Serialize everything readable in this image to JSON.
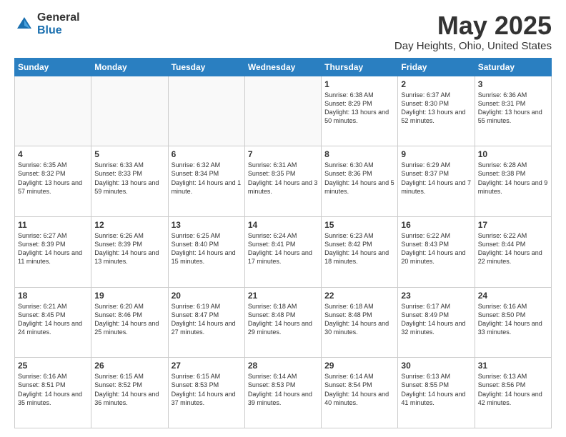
{
  "logo": {
    "general": "General",
    "blue": "Blue"
  },
  "title": "May 2025",
  "subtitle": "Day Heights, Ohio, United States",
  "headers": [
    "Sunday",
    "Monday",
    "Tuesday",
    "Wednesday",
    "Thursday",
    "Friday",
    "Saturday"
  ],
  "weeks": [
    [
      {
        "day": "",
        "text": ""
      },
      {
        "day": "",
        "text": ""
      },
      {
        "day": "",
        "text": ""
      },
      {
        "day": "",
        "text": ""
      },
      {
        "day": "1",
        "text": "Sunrise: 6:38 AM\nSunset: 8:29 PM\nDaylight: 13 hours and 50 minutes."
      },
      {
        "day": "2",
        "text": "Sunrise: 6:37 AM\nSunset: 8:30 PM\nDaylight: 13 hours and 52 minutes."
      },
      {
        "day": "3",
        "text": "Sunrise: 6:36 AM\nSunset: 8:31 PM\nDaylight: 13 hours and 55 minutes."
      }
    ],
    [
      {
        "day": "4",
        "text": "Sunrise: 6:35 AM\nSunset: 8:32 PM\nDaylight: 13 hours and 57 minutes."
      },
      {
        "day": "5",
        "text": "Sunrise: 6:33 AM\nSunset: 8:33 PM\nDaylight: 13 hours and 59 minutes."
      },
      {
        "day": "6",
        "text": "Sunrise: 6:32 AM\nSunset: 8:34 PM\nDaylight: 14 hours and 1 minute."
      },
      {
        "day": "7",
        "text": "Sunrise: 6:31 AM\nSunset: 8:35 PM\nDaylight: 14 hours and 3 minutes."
      },
      {
        "day": "8",
        "text": "Sunrise: 6:30 AM\nSunset: 8:36 PM\nDaylight: 14 hours and 5 minutes."
      },
      {
        "day": "9",
        "text": "Sunrise: 6:29 AM\nSunset: 8:37 PM\nDaylight: 14 hours and 7 minutes."
      },
      {
        "day": "10",
        "text": "Sunrise: 6:28 AM\nSunset: 8:38 PM\nDaylight: 14 hours and 9 minutes."
      }
    ],
    [
      {
        "day": "11",
        "text": "Sunrise: 6:27 AM\nSunset: 8:39 PM\nDaylight: 14 hours and 11 minutes."
      },
      {
        "day": "12",
        "text": "Sunrise: 6:26 AM\nSunset: 8:39 PM\nDaylight: 14 hours and 13 minutes."
      },
      {
        "day": "13",
        "text": "Sunrise: 6:25 AM\nSunset: 8:40 PM\nDaylight: 14 hours and 15 minutes."
      },
      {
        "day": "14",
        "text": "Sunrise: 6:24 AM\nSunset: 8:41 PM\nDaylight: 14 hours and 17 minutes."
      },
      {
        "day": "15",
        "text": "Sunrise: 6:23 AM\nSunset: 8:42 PM\nDaylight: 14 hours and 18 minutes."
      },
      {
        "day": "16",
        "text": "Sunrise: 6:22 AM\nSunset: 8:43 PM\nDaylight: 14 hours and 20 minutes."
      },
      {
        "day": "17",
        "text": "Sunrise: 6:22 AM\nSunset: 8:44 PM\nDaylight: 14 hours and 22 minutes."
      }
    ],
    [
      {
        "day": "18",
        "text": "Sunrise: 6:21 AM\nSunset: 8:45 PM\nDaylight: 14 hours and 24 minutes."
      },
      {
        "day": "19",
        "text": "Sunrise: 6:20 AM\nSunset: 8:46 PM\nDaylight: 14 hours and 25 minutes."
      },
      {
        "day": "20",
        "text": "Sunrise: 6:19 AM\nSunset: 8:47 PM\nDaylight: 14 hours and 27 minutes."
      },
      {
        "day": "21",
        "text": "Sunrise: 6:18 AM\nSunset: 8:48 PM\nDaylight: 14 hours and 29 minutes."
      },
      {
        "day": "22",
        "text": "Sunrise: 6:18 AM\nSunset: 8:48 PM\nDaylight: 14 hours and 30 minutes."
      },
      {
        "day": "23",
        "text": "Sunrise: 6:17 AM\nSunset: 8:49 PM\nDaylight: 14 hours and 32 minutes."
      },
      {
        "day": "24",
        "text": "Sunrise: 6:16 AM\nSunset: 8:50 PM\nDaylight: 14 hours and 33 minutes."
      }
    ],
    [
      {
        "day": "25",
        "text": "Sunrise: 6:16 AM\nSunset: 8:51 PM\nDaylight: 14 hours and 35 minutes."
      },
      {
        "day": "26",
        "text": "Sunrise: 6:15 AM\nSunset: 8:52 PM\nDaylight: 14 hours and 36 minutes."
      },
      {
        "day": "27",
        "text": "Sunrise: 6:15 AM\nSunset: 8:53 PM\nDaylight: 14 hours and 37 minutes."
      },
      {
        "day": "28",
        "text": "Sunrise: 6:14 AM\nSunset: 8:53 PM\nDaylight: 14 hours and 39 minutes."
      },
      {
        "day": "29",
        "text": "Sunrise: 6:14 AM\nSunset: 8:54 PM\nDaylight: 14 hours and 40 minutes."
      },
      {
        "day": "30",
        "text": "Sunrise: 6:13 AM\nSunset: 8:55 PM\nDaylight: 14 hours and 41 minutes."
      },
      {
        "day": "31",
        "text": "Sunrise: 6:13 AM\nSunset: 8:56 PM\nDaylight: 14 hours and 42 minutes."
      }
    ]
  ]
}
